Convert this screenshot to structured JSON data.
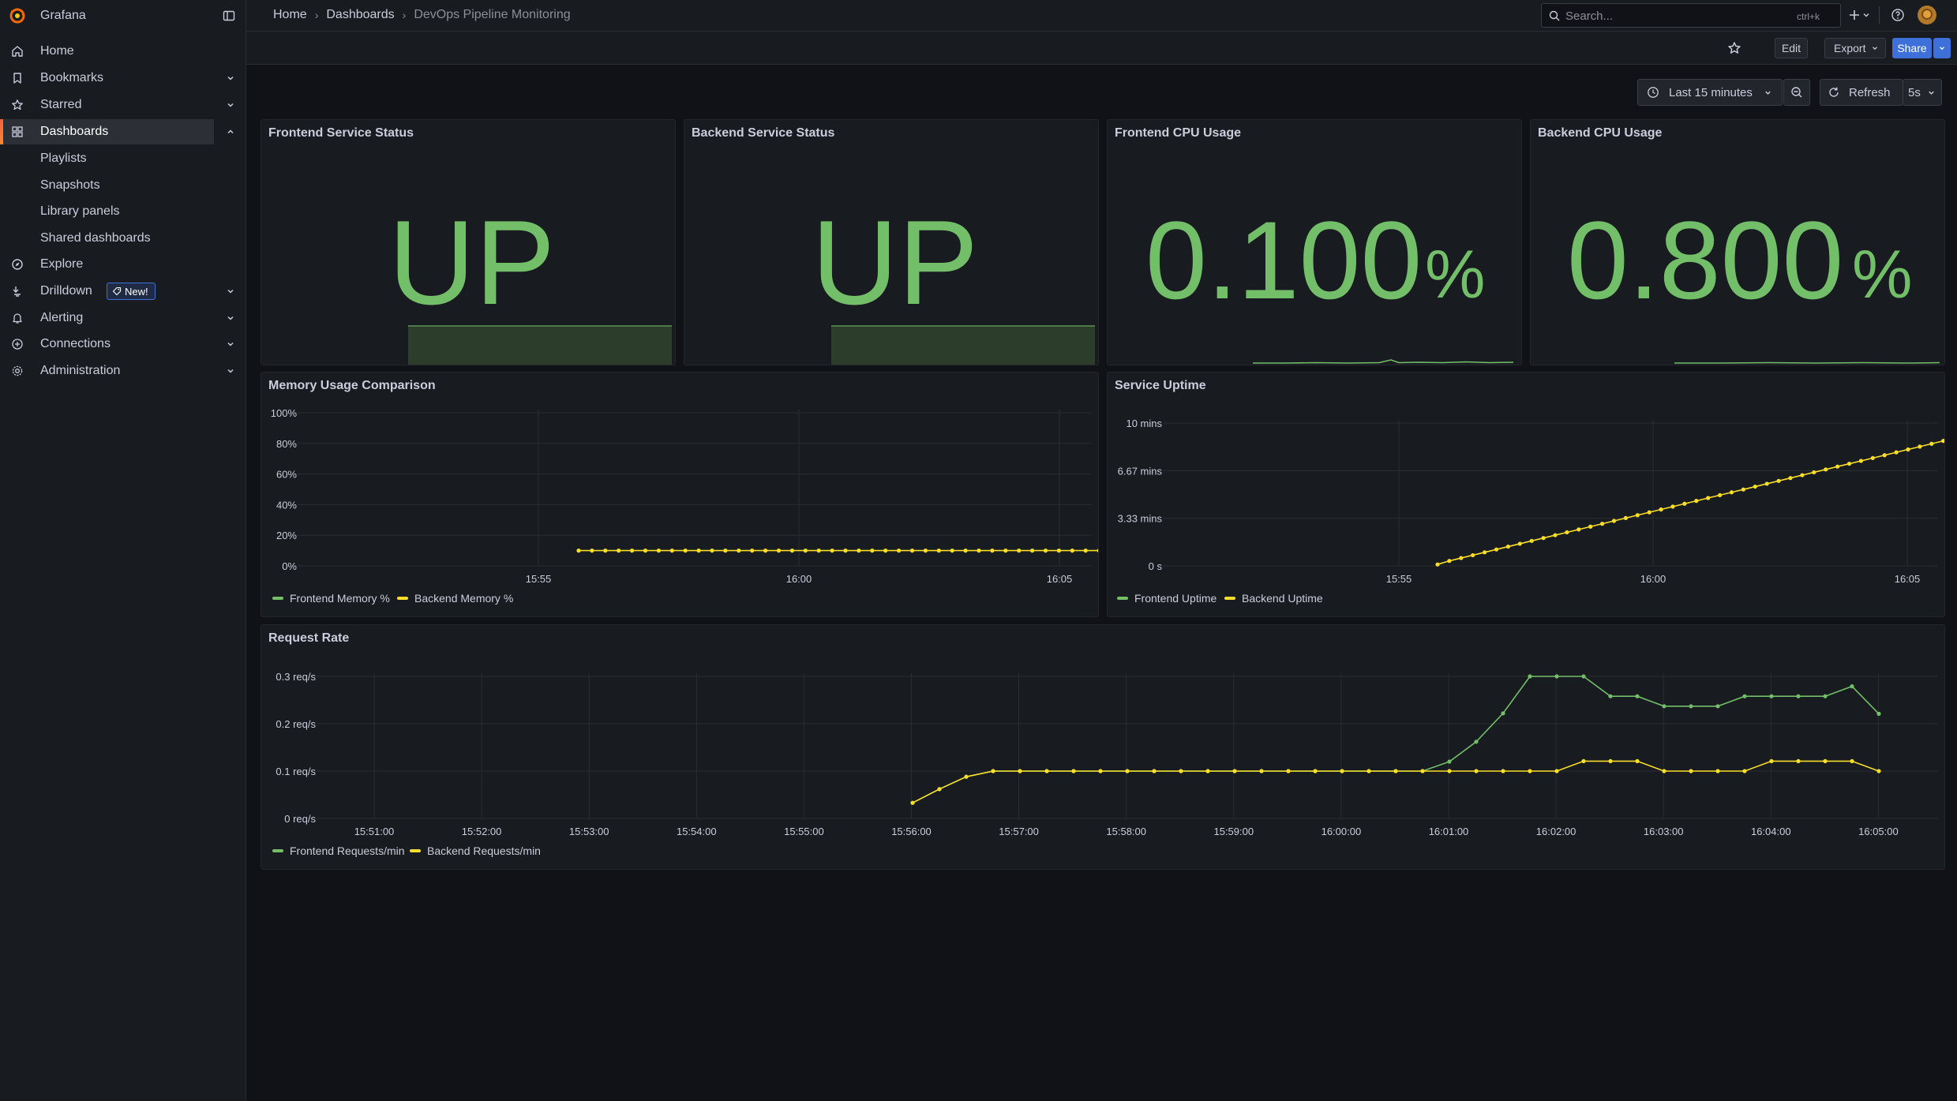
{
  "app": {
    "name": "Grafana"
  },
  "sidebar": {
    "items": [
      {
        "label": "Home",
        "icon": "home-icon",
        "chevron": false
      },
      {
        "label": "Bookmarks",
        "icon": "bookmark-icon",
        "chevron": true
      },
      {
        "label": "Starred",
        "icon": "star-icon",
        "chevron": true
      },
      {
        "label": "Dashboards",
        "icon": "dashboards-icon",
        "chevron": true,
        "active": true
      },
      {
        "label": "Explore",
        "icon": "explore-icon",
        "chevron": false
      },
      {
        "label": "Drilldown",
        "icon": "drilldown-icon",
        "chevron": true,
        "badge": "New!"
      },
      {
        "label": "Alerting",
        "icon": "bell-icon",
        "chevron": true
      },
      {
        "label": "Connections",
        "icon": "connections-icon",
        "chevron": true
      },
      {
        "label": "Administration",
        "icon": "gear-icon",
        "chevron": true
      }
    ],
    "dashboards_children": [
      "Playlists",
      "Snapshots",
      "Library panels",
      "Shared dashboards"
    ]
  },
  "breadcrumb": [
    "Home",
    "Dashboards",
    "DevOps Pipeline Monitoring"
  ],
  "search": {
    "placeholder": "Search...",
    "shortcut": "ctrl+k"
  },
  "toolbar": {
    "edit": "Edit",
    "export": "Export",
    "share": "Share"
  },
  "timepicker": {
    "range": "Last 15 minutes",
    "refresh": "Refresh",
    "interval": "5s"
  },
  "colors": {
    "green": "#73bf69",
    "yellow": "#fade2a",
    "accent": "#3d71d9",
    "brand": "#f46800"
  },
  "panels": {
    "frontend_status": {
      "title": "Frontend Service Status",
      "value": "UP"
    },
    "backend_status": {
      "title": "Backend Service Status",
      "value": "UP"
    },
    "frontend_cpu": {
      "title": "Frontend CPU Usage",
      "value": "0.100",
      "unit": "%"
    },
    "backend_cpu": {
      "title": "Backend CPU Usage",
      "value": "0.800",
      "unit": "%"
    },
    "memory": {
      "title": "Memory Usage Comparison"
    },
    "uptime": {
      "title": "Service Uptime"
    },
    "requests": {
      "title": "Request Rate"
    }
  },
  "chart_data": [
    {
      "type": "line",
      "title": "Memory Usage Comparison",
      "y_ticks": [
        "0%",
        "20%",
        "40%",
        "60%",
        "80%",
        "100%"
      ],
      "ylim": [
        0,
        100
      ],
      "x_ticks": [
        "15:55",
        "16:00",
        "16:05"
      ],
      "series": [
        {
          "name": "Frontend Memory %",
          "color": "#73bf69",
          "values": []
        },
        {
          "name": "Backend Memory %",
          "color": "#fade2a",
          "values": [
            10,
            10,
            10,
            10,
            10,
            10,
            10,
            10,
            10,
            10,
            10,
            10,
            10,
            10,
            10,
            10,
            10,
            10,
            10,
            10,
            10,
            10,
            10,
            10,
            10,
            10,
            10,
            10,
            10,
            10,
            10,
            10,
            10,
            10,
            10,
            10,
            10,
            10,
            10,
            10,
            10,
            10
          ]
        }
      ],
      "legend": "bottom-left"
    },
    {
      "type": "line",
      "title": "Service Uptime",
      "y_ticks": [
        "0 s",
        "3.33 mins",
        "6.67 mins",
        "10 mins"
      ],
      "ylim_mins": [
        0,
        10
      ],
      "x_ticks": [
        "15:55",
        "16:00",
        "16:05"
      ],
      "series": [
        {
          "name": "Frontend Uptime",
          "color": "#73bf69",
          "values": []
        },
        {
          "name": "Backend Uptime",
          "color": "#fade2a",
          "values": [
            0.1,
            0.35,
            0.55,
            0.75,
            0.95,
            1.15,
            1.35,
            1.55,
            1.75,
            1.95,
            2.15,
            2.35,
            2.55,
            2.75,
            2.95,
            3.15,
            3.35,
            3.55,
            3.75,
            3.95,
            4.15,
            4.35,
            4.55,
            4.75,
            4.95,
            5.15,
            5.35,
            5.55,
            5.75,
            5.95,
            6.15,
            6.35,
            6.55,
            6.75,
            6.95,
            7.15,
            7.35,
            7.55,
            7.75,
            7.95,
            8.15,
            8.35,
            8.55,
            8.75,
            8.95,
            9.1,
            9.25
          ]
        }
      ],
      "legend": "bottom-left"
    },
    {
      "type": "line",
      "title": "Request Rate",
      "y_ticks": [
        "0 req/s",
        "0.1 req/s",
        "0.2 req/s",
        "0.3 req/s"
      ],
      "ylim": [
        0,
        0.3
      ],
      "x_ticks": [
        "15:51:00",
        "15:52:00",
        "15:53:00",
        "15:54:00",
        "15:55:00",
        "15:56:00",
        "15:57:00",
        "15:58:00",
        "15:59:00",
        "16:00:00",
        "16:01:00",
        "16:02:00",
        "16:03:00",
        "16:04:00",
        "16:05:00"
      ],
      "series": [
        {
          "name": "Frontend Requests/min",
          "color": "#73bf69",
          "values": [
            0.033,
            0.062,
            0.088,
            0.1,
            0.1,
            0.1,
            0.1,
            0.1,
            0.1,
            0.1,
            0.1,
            0.1,
            0.1,
            0.1,
            0.1,
            0.1,
            0.1,
            0.1,
            0.1,
            0.1,
            0.12,
            0.162,
            0.222,
            0.3,
            0.3,
            0.3,
            0.258,
            0.258,
            0.237,
            0.237,
            0.237,
            0.258,
            0.258,
            0.258,
            0.258,
            0.279,
            0.221
          ]
        },
        {
          "name": "Backend Requests/min",
          "color": "#fade2a",
          "values": [
            0.033,
            0.062,
            0.088,
            0.1,
            0.1,
            0.1,
            0.1,
            0.1,
            0.1,
            0.1,
            0.1,
            0.1,
            0.1,
            0.1,
            0.1,
            0.1,
            0.1,
            0.1,
            0.1,
            0.1,
            0.1,
            0.1,
            0.1,
            0.1,
            0.1,
            0.121,
            0.121,
            0.121,
            0.1,
            0.1,
            0.1,
            0.1,
            0.121,
            0.121,
            0.121,
            0.121,
            0.1
          ]
        }
      ],
      "legend": "bottom-left"
    }
  ]
}
